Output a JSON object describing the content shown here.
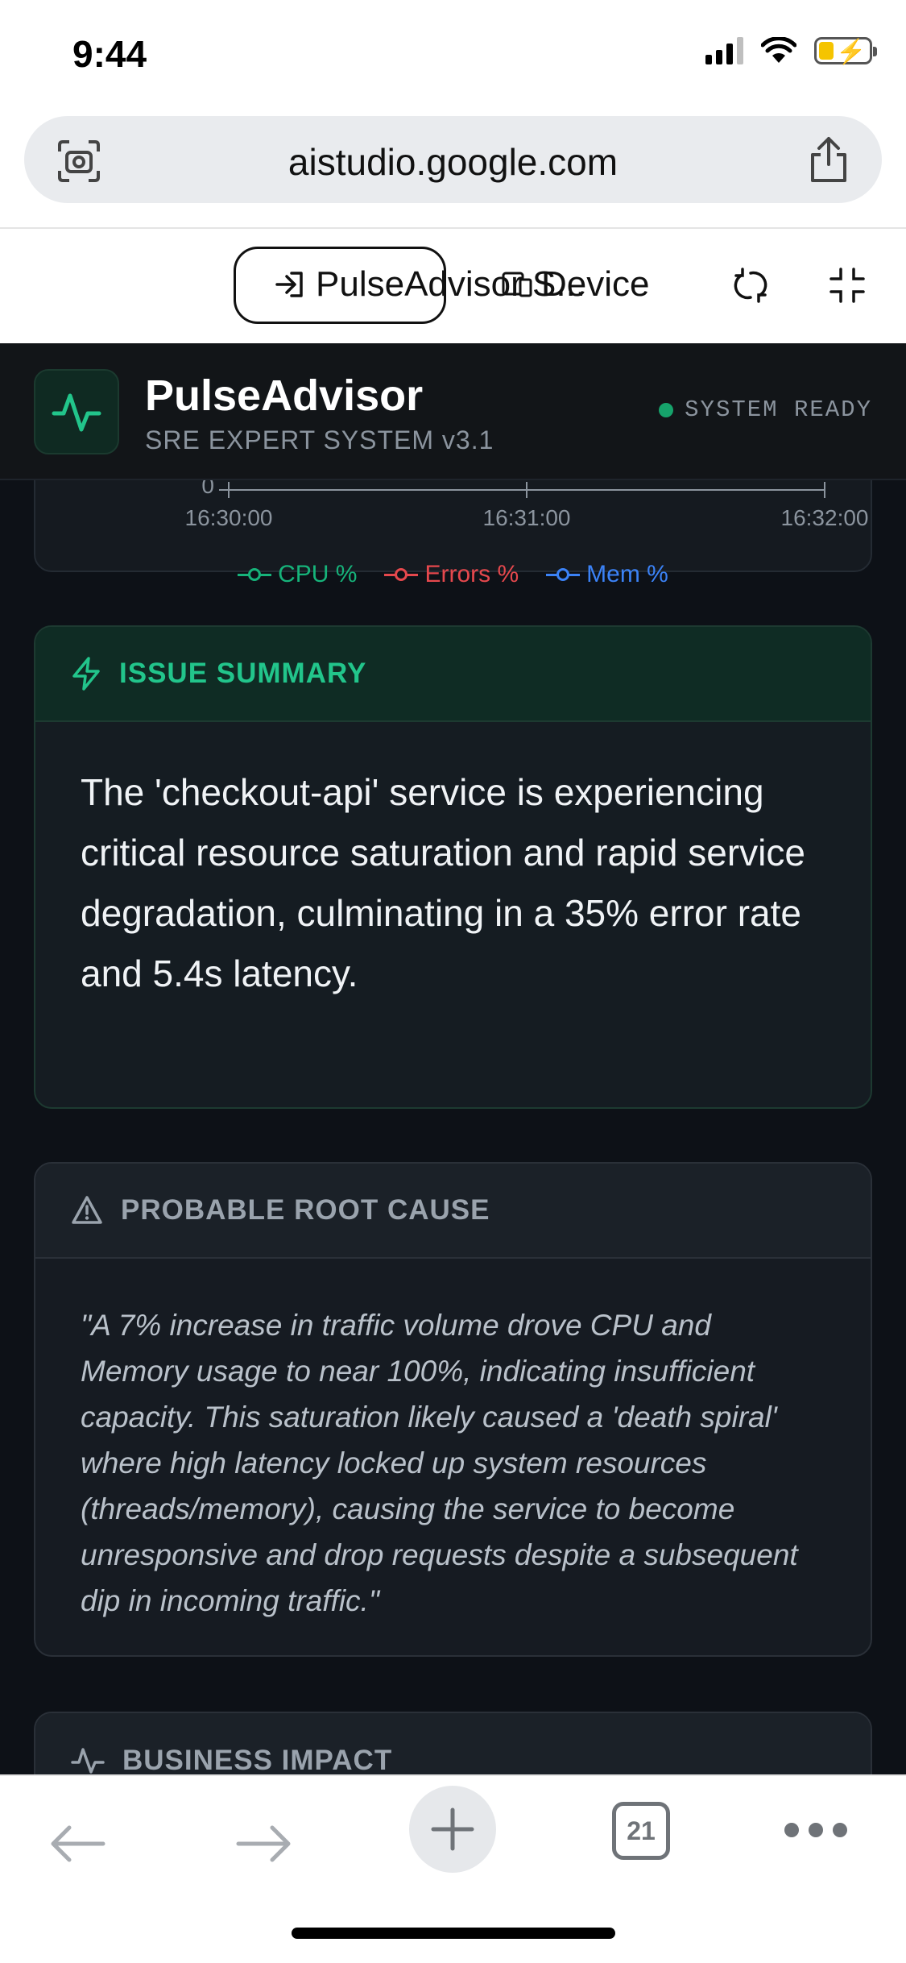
{
  "status_bar": {
    "time": "9:44"
  },
  "browser": {
    "url": "aistudio.google.com",
    "tab_count": "21"
  },
  "studio_toolbar": {
    "app_label": "PulseAdvisor S...",
    "device_label": "Device"
  },
  "app": {
    "title": "PulseAdvisor",
    "subtitle": "SRE EXPERT SYSTEM v3.1",
    "status": "SYSTEM READY",
    "accent_color": "#16a36b"
  },
  "chart_data": {
    "type": "line",
    "x_ticks": [
      "16:30:00",
      "16:31:00",
      "16:32:00"
    ],
    "y_tick_visible": "0",
    "series": [
      {
        "name": "CPU %",
        "color": "#16b37a"
      },
      {
        "name": "Errors %",
        "color": "#e5484d"
      },
      {
        "name": "Mem %",
        "color": "#3b82f6"
      }
    ]
  },
  "issue_summary": {
    "title": "ISSUE SUMMARY",
    "text": "The 'checkout-api' service is experiencing critical resource saturation and rapid service degradation, culminating in a 35% error rate and 5.4s latency."
  },
  "root_cause": {
    "title": "PROBABLE ROOT CAUSE",
    "text": "\"A 7% increase in traffic volume drove CPU and Memory usage to near 100%, indicating insufficient capacity. This saturation likely caused a 'death spiral' where high latency locked up system resources (threads/memory), causing the service to become unresponsive and drop requests despite a subsequent dip in incoming traffic.\""
  },
  "business_impact": {
    "title": "BUSINESS IMPACT"
  }
}
